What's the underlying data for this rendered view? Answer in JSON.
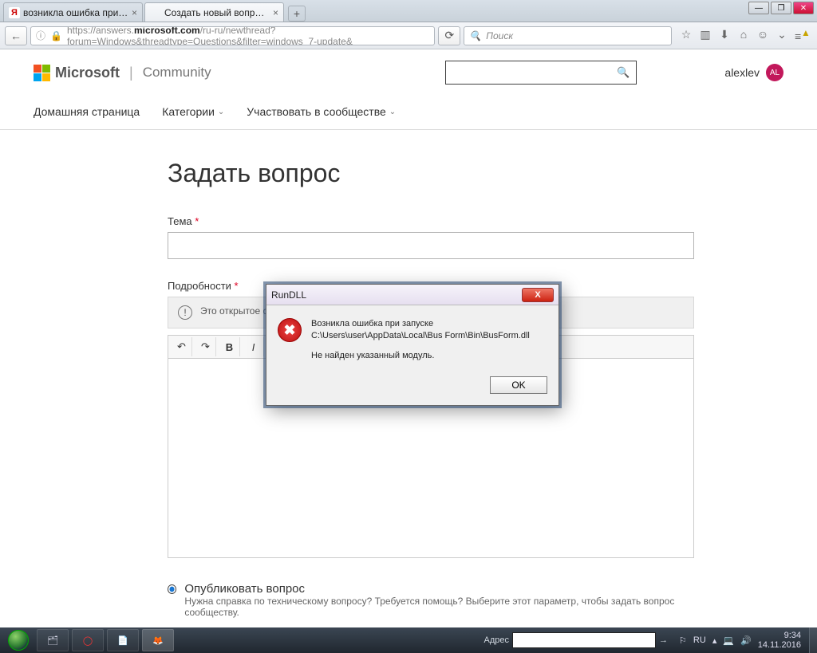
{
  "browser": {
    "tabs": [
      {
        "title": "возникла ошибка при зап..."
      },
      {
        "title": "Создать новый вопрос ил..."
      }
    ],
    "url_display": "https://answers.microsoft.com/ru-ru/newthread?forum=Windows&threadtype=Questions&filter=windows_7-update&",
    "url_host": "microsoft.com",
    "url_prefix": "https://answers.",
    "url_suffix": "/ru-ru/newthread?forum=Windows&threadtype=Questions&filter=windows_7-update&",
    "search_placeholder": "Поиск"
  },
  "header": {
    "brand": "Microsoft",
    "section": "Community",
    "user_name": "alexlev",
    "user_initials": "AL"
  },
  "nav": {
    "home": "Домашняя страница",
    "categories": "Категории",
    "participate": "Участвовать в сообществе"
  },
  "form": {
    "heading": "Задать вопрос",
    "subject_label": "Тема",
    "details_label": "Подробности",
    "notice": "Это открытое сообщество, электронный адрес, номер",
    "publish_title": "Опубликовать вопрос",
    "publish_desc": "Нужна справка по техническому вопросу? Требуется помощь? Выберите этот параметр, чтобы задать вопрос сообществу."
  },
  "dialog": {
    "title": "RunDLL",
    "line1": "Возникла ошибка при запуске C:\\Users\\user\\AppData\\Local\\Bus Form\\Bin\\BusForm.dll",
    "line2": "Не найден указанный модуль.",
    "ok": "OK"
  },
  "taskbar": {
    "address_label": "Адрес",
    "lang": "RU",
    "time": "9:34",
    "date": "14.11.2016"
  }
}
